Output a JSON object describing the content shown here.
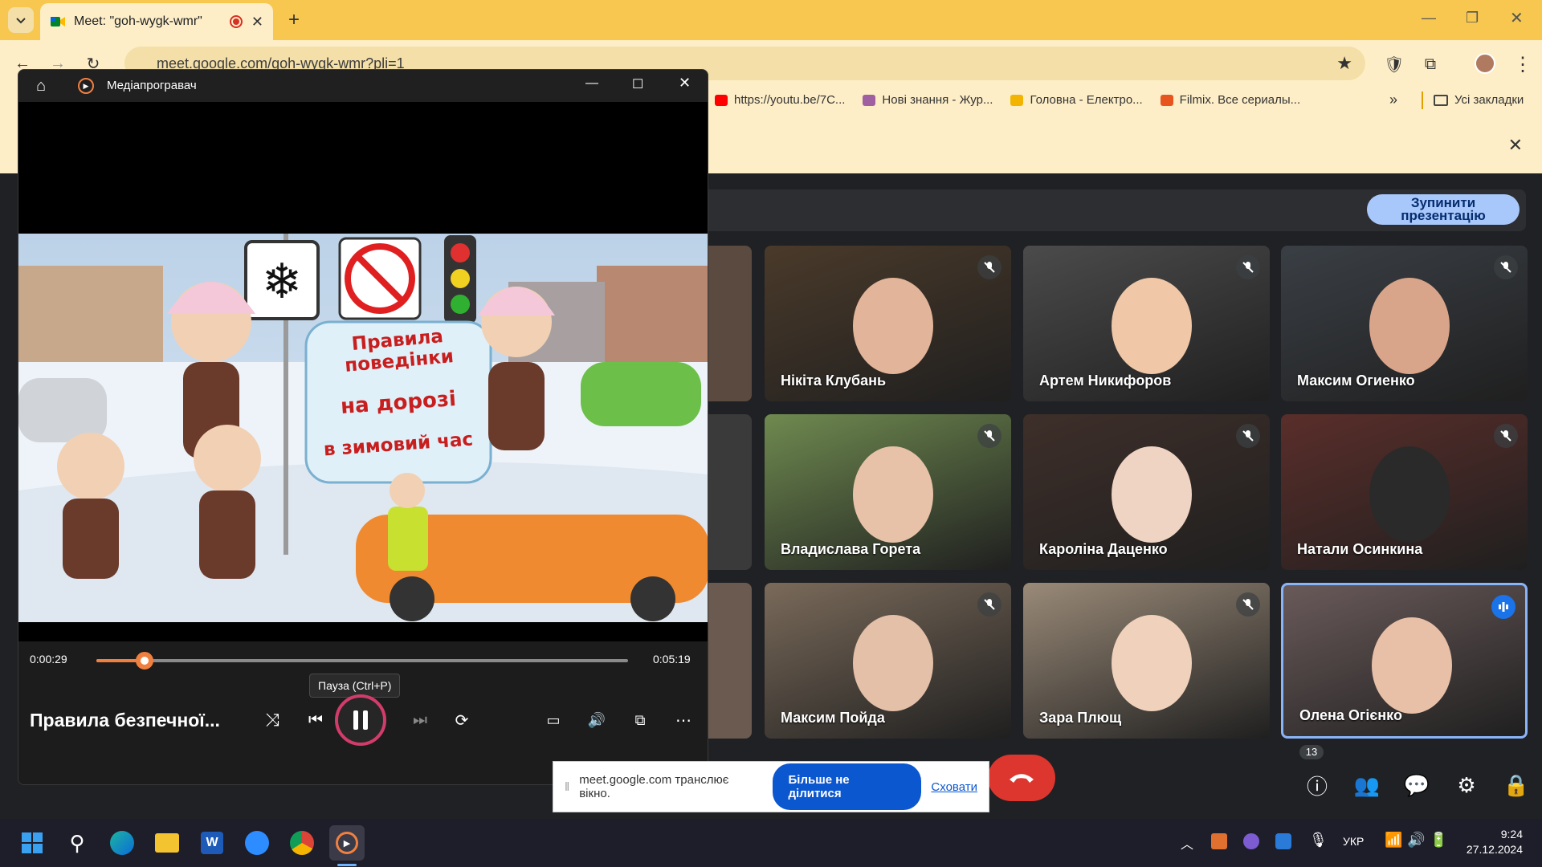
{
  "browser": {
    "tab_title": "Meet: \"goh-wygk-wmr\"",
    "url": "meet.google.com/goh-wygk-wmr?pli=1",
    "bookmarks": [
      {
        "label": "https://youtu.be/7C...",
        "icon": "youtube-icon",
        "color": "#ff0000"
      },
      {
        "label": "Нові знання - Жур...",
        "icon": "site-icon",
        "color": "#a05fa0"
      },
      {
        "label": "Головна - Електро...",
        "icon": "sun-icon",
        "color": "#f2b400"
      },
      {
        "label": "Filmix. Все сериалы...",
        "icon": "filmix-icon",
        "color": "#e8541e"
      }
    ],
    "all_bookmarks": "Усі закладки"
  },
  "meet": {
    "stop_presentation": "Зупинити презентацію",
    "participants_count": "13",
    "tiles": [
      {
        "name": "Нікіта Клубань",
        "muted": true,
        "bg": "#4a3a2a",
        "skin": "#e2b59a"
      },
      {
        "name": "Артем Никифоров",
        "muted": true,
        "bg": "#4b4b4b",
        "skin": "#f0c8a8"
      },
      {
        "name": "Максим Огиенко",
        "muted": true,
        "bg": "#3a3f45",
        "skin": "#d9a58a"
      },
      {
        "name": "Владислава Горета",
        "muted": true,
        "bg": "#6f8a50",
        "skin": "#e8c2a8"
      },
      {
        "name": "Кароліна Даценко",
        "muted": true,
        "bg": "#3e2f2a",
        "skin": "#efd3c3"
      },
      {
        "name": "Натали Осинкина",
        "muted": true,
        "bg": "#5a2e2a",
        "skin": "#2a2a2a"
      },
      {
        "name": "Максим Пойда",
        "muted": true,
        "bg": "#7a6a5a",
        "skin": "#e4c0a8"
      },
      {
        "name": "Зара Плющ",
        "muted": true,
        "bg": "#9a8a78",
        "skin": "#f0d2bc"
      },
      {
        "name": "Олена Огієнко",
        "muted": false,
        "bg": "#6a5a5a",
        "skin": "#e8c0a8"
      }
    ]
  },
  "player": {
    "app_title": "Медіапрогравач",
    "current_time": "0:00:29",
    "total_time": "0:05:19",
    "progress": 0.09,
    "tooltip": "Пауза (Ctrl+P)",
    "media_title": "Правила безпечної...",
    "slide": {
      "line1": "Правила поведінки",
      "line2": "на дорозі",
      "line3": "в зимовий час"
    }
  },
  "share": {
    "message": "meet.google.com транслює вікно.",
    "stop_button": "Більше не ділитися",
    "hide": "Сховати"
  },
  "taskbar": {
    "language": "УКР",
    "time": "9:24",
    "date": "27.12.2024"
  }
}
